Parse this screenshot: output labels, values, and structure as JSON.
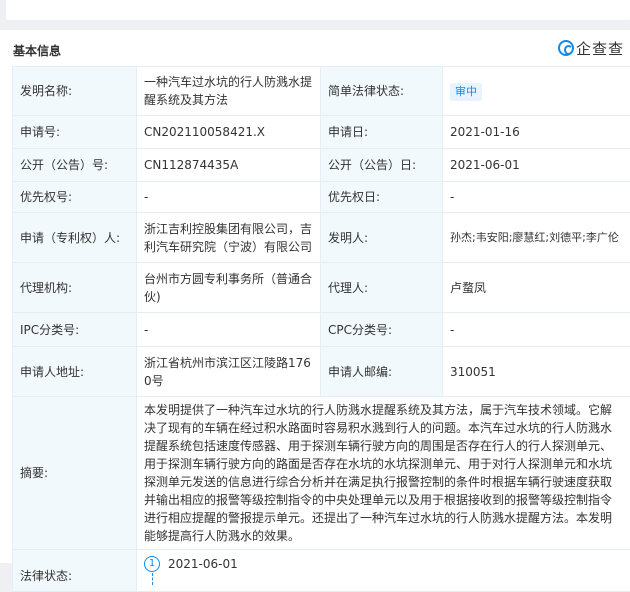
{
  "section": {
    "title": "基本信息"
  },
  "brand": {
    "icon": "qichacha-logo-icon",
    "text": "企查查",
    "color": "#128bed"
  },
  "rows": [
    {
      "l1": "发明名称:",
      "v1": "一种汽车过水坑的行人防溅水提醒系统及其方法",
      "l2": "简单法律状态:",
      "v2": "审中"
    },
    {
      "l1": "申请号:",
      "v1": "CN202110058421.X",
      "l2": "申请日:",
      "v2": "2021-01-16"
    },
    {
      "l1": "公开（公告）号:",
      "v1": "CN112874435A",
      "l2": "公开（公告）日:",
      "v2": "2021-06-01"
    },
    {
      "l1": "优先权号:",
      "v1": "-",
      "l2": "优先权日:",
      "v2": "-"
    },
    {
      "l1": "申请（专利权）人:",
      "v1": "浙江吉利控股集团有限公司，吉利汽车研究院（宁波）有限公司",
      "l2": "发明人:",
      "v2": "孙杰;韦安阳;廖慧红;刘德平;李广伦"
    },
    {
      "l1": "代理机构:",
      "v1": "台州市方圆专利事务所（普通合伙)",
      "l2": "代理人:",
      "v2": "卢蝥凤"
    },
    {
      "l1": "IPC分类号:",
      "v1": "-",
      "l2": "CPC分类号:",
      "v2": "-"
    },
    {
      "l1": "申请人地址:",
      "v1": "浙江省杭州市滨江区江陵路1760号",
      "l2": "申请人邮编:",
      "v2": "310051"
    }
  ],
  "abstract": {
    "label": "摘要:",
    "text": "本发明提供了一种汽车过水坑的行人防溅水提醒系统及其方法，属于汽车技术领域。它解决了现有的车辆在经过积水路面时容易积水溅到行人的问题。本汽车过水坑的行人防溅水提醒系统包括速度传感器、用于探测车辆行驶方向的周围是否存在行人的行人探测单元、用于探测车辆行驶方向的路面是否存在水坑的水坑探测单元、用于对行人探测单元和水坑探测单元发送的信息进行综合分析并在满足执行报警控制的条件时根据车辆行驶速度获取并输出相应的报警等级控制指令的中央处理单元以及用于根据接收到的报警等级控制指令进行相应提醒的警报提示单元。还提出了一种汽车过水坑的行人防溅水提醒方法。本发明能够提高行人防溅水的效果。"
  },
  "legal_status": {
    "label": "法律状态:",
    "step": "1",
    "date": "2021-06-01"
  }
}
